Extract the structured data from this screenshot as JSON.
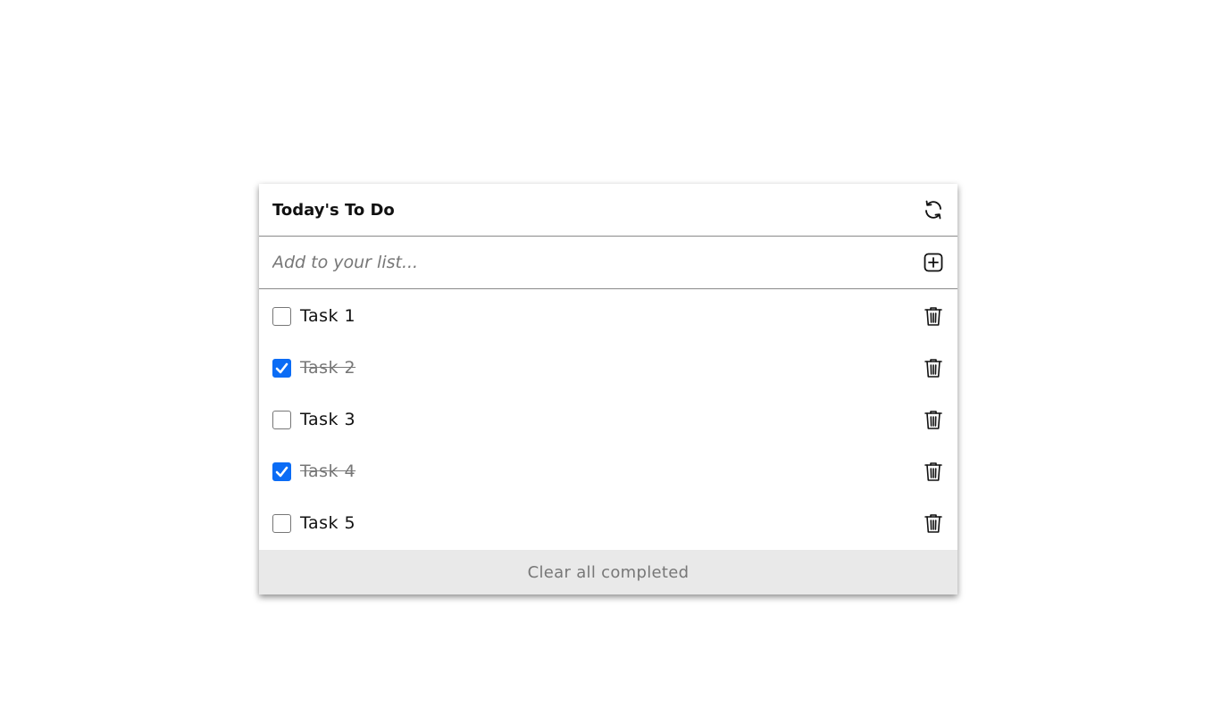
{
  "header": {
    "title": "Today's To Do",
    "refresh_icon": "refresh-icon"
  },
  "add": {
    "placeholder": "Add to your list...",
    "value": "",
    "add_icon": "plus-square-icon"
  },
  "tasks": [
    {
      "label": "Task 1",
      "completed": false
    },
    {
      "label": "Task 2",
      "completed": true
    },
    {
      "label": "Task 3",
      "completed": false
    },
    {
      "label": "Task 4",
      "completed": true
    },
    {
      "label": "Task 5",
      "completed": false
    }
  ],
  "delete_icon": "trash-icon",
  "footer": {
    "clear_label": "Clear all completed"
  },
  "colors": {
    "checkbox_checked": "#0b6cf5",
    "footer_bg": "#e9e9e9"
  }
}
